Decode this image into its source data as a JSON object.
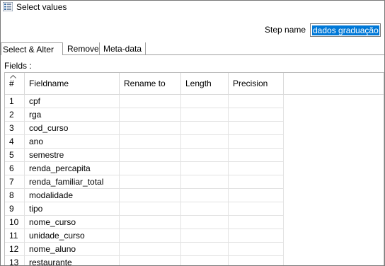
{
  "window": {
    "title": "Select values",
    "icon": "select-values-icon"
  },
  "step": {
    "label": "Step name",
    "value": "dados graduação"
  },
  "tabs": [
    {
      "label": "Select & Alter",
      "active": true
    },
    {
      "label": "Remove",
      "active": false
    },
    {
      "label": "Meta-data",
      "active": false
    }
  ],
  "fields_label": "Fields :",
  "table": {
    "headers": [
      "#",
      "Fieldname",
      "Rename to",
      "Length",
      "Precision"
    ],
    "rows": [
      {
        "n": "1",
        "field": "cpf"
      },
      {
        "n": "2",
        "field": "rga"
      },
      {
        "n": "3",
        "field": "cod_curso"
      },
      {
        "n": "4",
        "field": "ano"
      },
      {
        "n": "5",
        "field": "semestre"
      },
      {
        "n": "6",
        "field": "renda_percapita"
      },
      {
        "n": "7",
        "field": "renda_familiar_total"
      },
      {
        "n": "8",
        "field": "modalidade"
      },
      {
        "n": "9",
        "field": "tipo"
      },
      {
        "n": "10",
        "field": "nome_curso"
      },
      {
        "n": "11",
        "field": "unidade_curso"
      },
      {
        "n": "12",
        "field": "nome_aluno"
      },
      {
        "n": "13",
        "field": "restaurante"
      }
    ]
  }
}
